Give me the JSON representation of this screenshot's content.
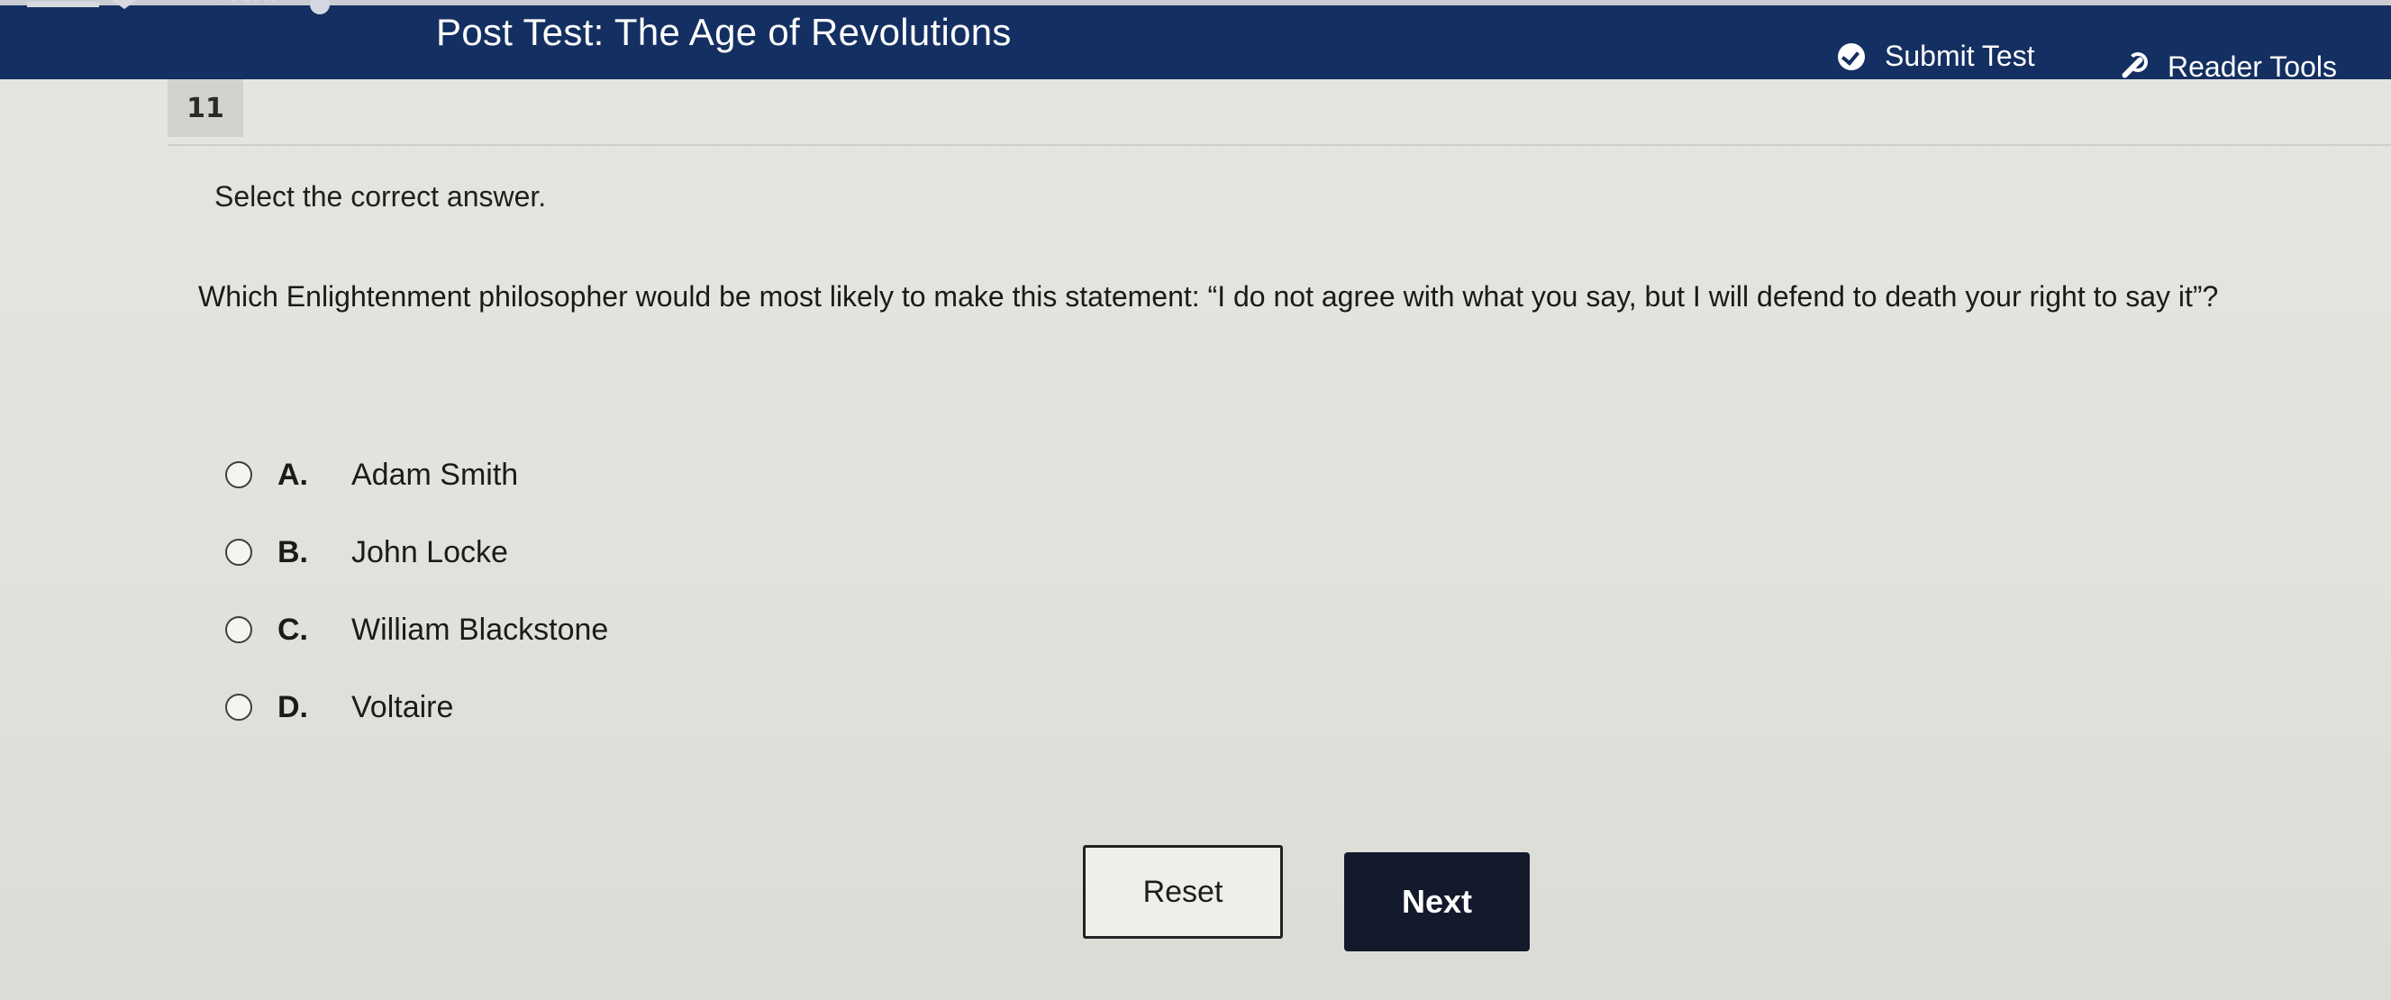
{
  "header": {
    "nav_next_label": "Next",
    "title": "Post Test: The Age of Revolutions",
    "submit_label": "Submit Test",
    "reader_tools_label": "Reader Tools"
  },
  "question": {
    "number": "11",
    "instruction": "Select the correct answer.",
    "prompt": "Which Enlightenment philosopher would be most likely to make this statement: “I do not agree with what you say, but I will defend to death your right to say it”?",
    "options": [
      {
        "letter": "A.",
        "text": "Adam Smith"
      },
      {
        "letter": "B.",
        "text": "John Locke"
      },
      {
        "letter": "C.",
        "text": "William Blackstone"
      },
      {
        "letter": "D.",
        "text": "Voltaire"
      }
    ]
  },
  "actions": {
    "reset_label": "Reset",
    "next_label": "Next"
  },
  "colors": {
    "header_bg": "#142f62",
    "next_button_bg": "#121a2c",
    "page_bg": "#e3e3de"
  }
}
